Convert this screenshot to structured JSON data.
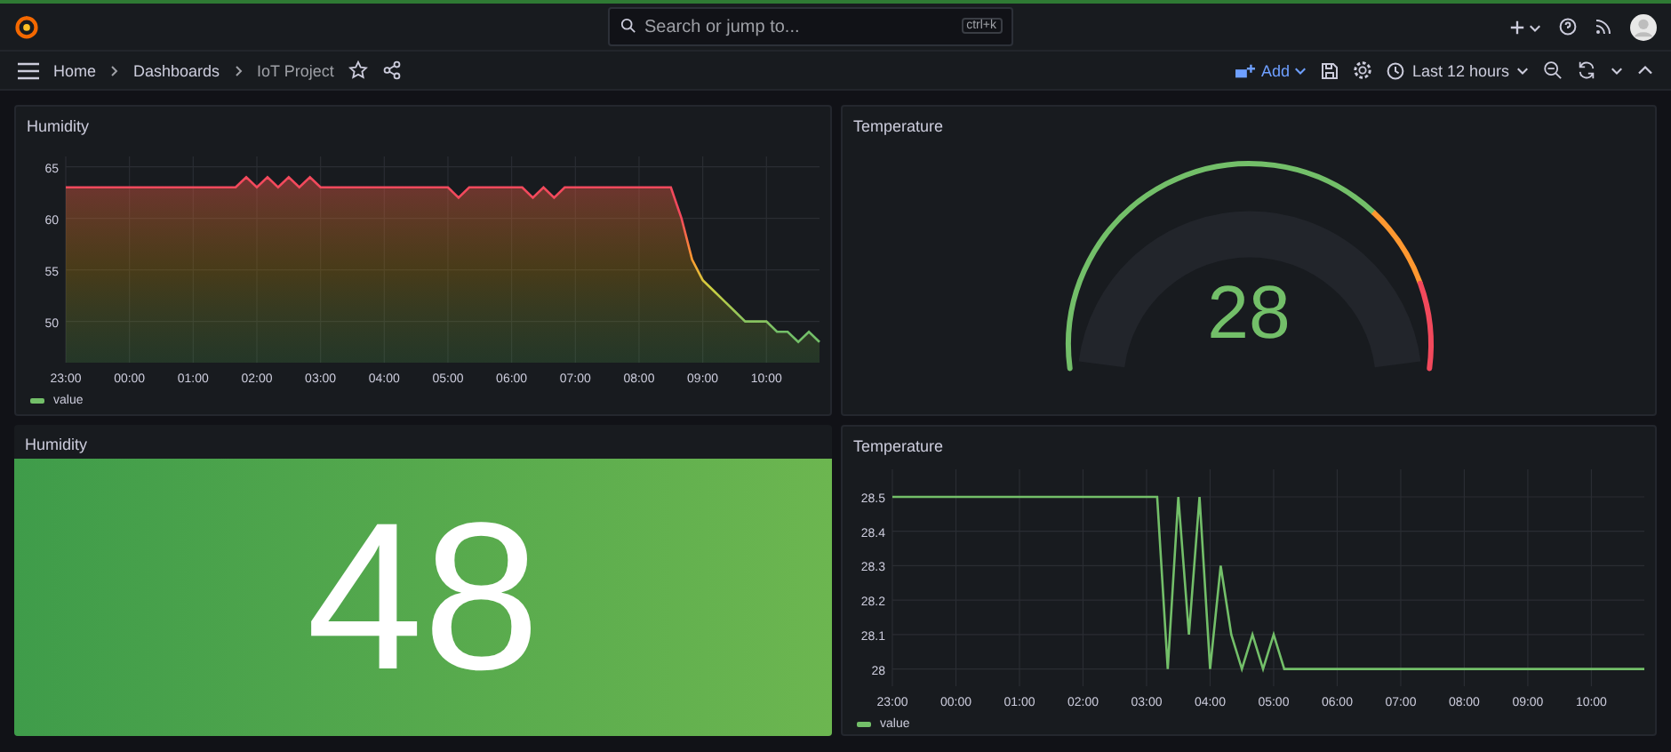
{
  "topbar": {
    "search": {
      "placeholder": "Search or jump to..."
    },
    "shortcut": "ctrl+k"
  },
  "breadcrumbs": [
    {
      "label": "Home",
      "selected": false
    },
    {
      "label": "Dashboards",
      "selected": false
    },
    {
      "label": "IoT Project",
      "selected": true
    }
  ],
  "toolbar": {
    "add_label": "Add",
    "time_range": "Last 12 hours"
  },
  "panels": [
    {
      "kind": "timeseries",
      "title": "Humidity",
      "chart_data": {
        "type": "area",
        "grid": true,
        "ylim": [
          46,
          66
        ],
        "yticks": [
          50,
          55,
          60,
          65
        ],
        "categories": [
          "23:00",
          null,
          null,
          null,
          null,
          null,
          "00:00",
          null,
          null,
          null,
          null,
          null,
          "01:00",
          null,
          null,
          null,
          null,
          null,
          "02:00",
          null,
          null,
          null,
          null,
          null,
          "03:00",
          null,
          null,
          null,
          null,
          null,
          "04:00",
          null,
          null,
          null,
          null,
          null,
          "05:00",
          null,
          null,
          null,
          null,
          null,
          "06:00",
          null,
          null,
          null,
          null,
          null,
          "07:00",
          null,
          null,
          null,
          null,
          null,
          "08:00",
          null,
          null,
          null,
          null,
          null,
          "09:00",
          null,
          null,
          null,
          null,
          null,
          "10:00",
          null,
          null,
          null,
          null,
          null
        ],
        "series": [
          {
            "name": "value",
            "color": "#73bf69",
            "values": [
              63,
              63,
              63,
              63,
              63,
              63,
              63,
              63,
              63,
              63,
              63,
              63,
              63,
              63,
              63,
              63,
              63,
              64,
              63,
              64,
              63,
              64,
              63,
              64,
              63,
              63,
              63,
              63,
              63,
              63,
              63,
              63,
              63,
              63,
              63,
              63,
              63,
              62,
              63,
              63,
              63,
              63,
              63,
              63,
              62,
              63,
              62,
              63,
              63,
              63,
              63,
              63,
              63,
              63,
              63,
              63,
              63,
              63,
              60,
              56,
              54,
              53,
              52,
              51,
              50,
              50,
              50,
              49,
              49,
              48,
              49,
              48
            ]
          }
        ]
      }
    },
    {
      "kind": "gauge",
      "title": "Temperature",
      "value": "28"
    },
    {
      "kind": "stat",
      "title": "Humidity",
      "value": "48"
    },
    {
      "kind": "timeseries",
      "title": "Temperature",
      "chart_data": {
        "type": "line",
        "grid": true,
        "ylim": [
          27.95,
          28.58
        ],
        "yticks": [
          28,
          28.1,
          28.2,
          28.3,
          28.4,
          28.5
        ],
        "categories": [
          "23:00",
          null,
          null,
          null,
          null,
          null,
          "00:00",
          null,
          null,
          null,
          null,
          null,
          "01:00",
          null,
          null,
          null,
          null,
          null,
          "02:00",
          null,
          null,
          null,
          null,
          null,
          "03:00",
          null,
          null,
          null,
          null,
          null,
          "04:00",
          null,
          null,
          null,
          null,
          null,
          "05:00",
          null,
          null,
          null,
          null,
          null,
          "06:00",
          null,
          null,
          null,
          null,
          null,
          "07:00",
          null,
          null,
          null,
          null,
          null,
          "08:00",
          null,
          null,
          null,
          null,
          null,
          "09:00",
          null,
          null,
          null,
          null,
          null,
          "10:00",
          null,
          null,
          null,
          null,
          null
        ],
        "series": [
          {
            "name": "value",
            "color": "#73bf69",
            "values": [
              28.5,
              28.5,
              28.5,
              28.5,
              28.5,
              28.5,
              28.5,
              28.5,
              28.5,
              28.5,
              28.5,
              28.5,
              28.5,
              28.5,
              28.5,
              28.5,
              28.5,
              28.5,
              28.5,
              28.5,
              28.5,
              28.5,
              28.5,
              28.5,
              28.5,
              28.5,
              28,
              28.5,
              28.1,
              28.5,
              28,
              28.3,
              28.1,
              28,
              28.1,
              28,
              28.1,
              28,
              28,
              28,
              28,
              28,
              28,
              28,
              28,
              28,
              28,
              28,
              28,
              28,
              28,
              28,
              28,
              28,
              28,
              28,
              28,
              28,
              28,
              28,
              28,
              28,
              28,
              28,
              28,
              28,
              28,
              28,
              28,
              28,
              28,
              28
            ]
          }
        ]
      }
    }
  ]
}
